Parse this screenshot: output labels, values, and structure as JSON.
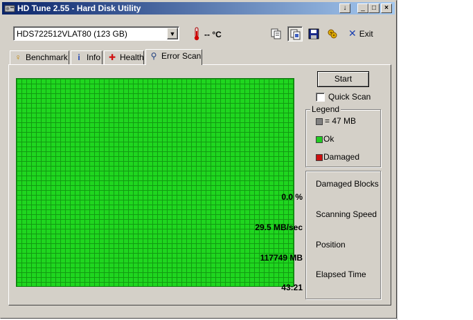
{
  "window": {
    "title": "HD Tune 2.55 - Hard Disk Utility",
    "caption_buttons": [
      "↓",
      "_",
      "□",
      "×"
    ]
  },
  "toolbar": {
    "drive": "HDS722512VLAT80 (123 GB)",
    "temperature": "-- °C",
    "buttons": [
      "copy-text-icon",
      "copy-screenshot-icon",
      "save-icon",
      "options-icon"
    ],
    "exit_label": "Exit"
  },
  "tabs": [
    {
      "label": "Benchmark",
      "icon": "benchmark-icon"
    },
    {
      "label": "Info",
      "icon": "info-icon"
    },
    {
      "label": "Health",
      "icon": "health-icon"
    },
    {
      "label": "Error Scan",
      "icon": "magnifier-icon",
      "active": true
    }
  ],
  "scan": {
    "start_label": "Start",
    "quick_scan_label": "Quick Scan",
    "quick_scan_checked": false,
    "block_state": "ok"
  },
  "legend": {
    "caption": "Legend",
    "items": [
      {
        "label": "= 47 MB",
        "color": "#808080"
      },
      {
        "label": "Ok",
        "color": "#22cc22"
      },
      {
        "label": "Damaged",
        "color": "#cc1111"
      }
    ]
  },
  "stats": {
    "damaged_blocks_label": "Damaged Blocks",
    "damaged_blocks_value": "0.0 %",
    "scanning_speed_label": "Scanning Speed",
    "scanning_speed_value": "29.5 MB/sec",
    "position_label": "Position",
    "position_value": "117749 MB",
    "elapsed_label": "Elapsed Time",
    "elapsed_value": "43:21"
  },
  "colors": {
    "titlebar_start": "#0a246a",
    "titlebar_end": "#a6caf0",
    "ok_block": "#22cc22",
    "face": "#d4d0c8"
  }
}
